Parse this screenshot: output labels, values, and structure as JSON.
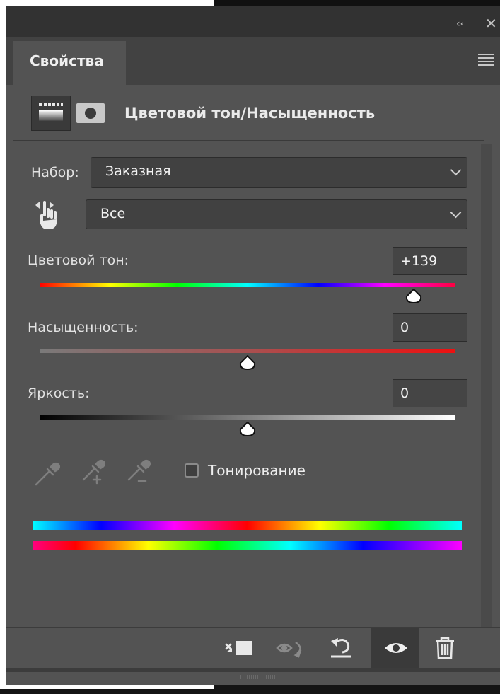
{
  "window": {
    "collapse_glyph": "‹‹",
    "close_glyph": "✕"
  },
  "tab": {
    "label": "Свойства"
  },
  "header": {
    "title": "Цветовой тон/Насыщенность",
    "adjustment_icon": "hue-saturation-adjustment-icon",
    "mask_icon": "layer-mask-icon"
  },
  "preset": {
    "label": "Набор:",
    "value": "Заказная"
  },
  "channel": {
    "value": "Все",
    "tool_icon": "targeted-adjustment-hand-icon"
  },
  "hue": {
    "label": "Цветовой тон:",
    "value": "+139",
    "position": 0.9
  },
  "saturation": {
    "label": "Насыщенность:",
    "value": "0",
    "position": 0.5
  },
  "lightness": {
    "label": "Яркость:",
    "value": "0",
    "position": 0.5
  },
  "eyedroppers": [
    "eyedropper-icon",
    "eyedropper-add-icon",
    "eyedropper-subtract-icon"
  ],
  "colorize": {
    "label": "Тонирование",
    "checked": false
  },
  "footer": {
    "buttons": [
      "clip-to-layer-icon",
      "view-previous-state-icon",
      "reset-icon",
      "visibility-eye-icon",
      "trash-icon"
    ]
  },
  "colors": {
    "panel_bg": "#535353",
    "field_bg": "#414141",
    "text": "#e6e6e6"
  }
}
